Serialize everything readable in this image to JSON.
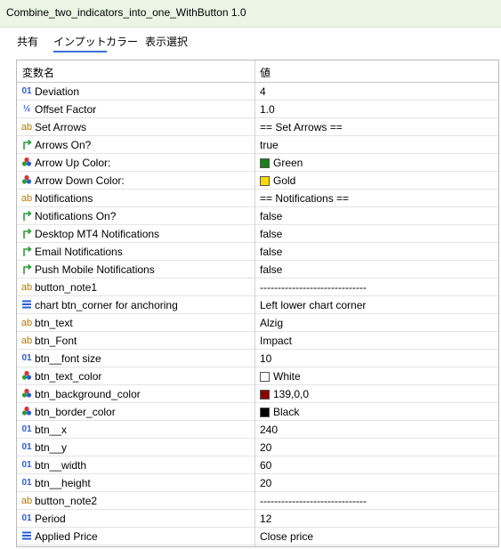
{
  "window": {
    "title": "Combine_two_indicators_into_one_WithButton 1.0"
  },
  "tabs": [
    {
      "label": "共有"
    },
    {
      "label": "インプット"
    },
    {
      "label": "カラー"
    },
    {
      "label": "表示選択"
    }
  ],
  "grid": {
    "header": {
      "name": "変数名",
      "value": "値"
    },
    "rows": [
      {
        "type": "int",
        "name": "Deviation",
        "value": "4"
      },
      {
        "type": "double",
        "name": "Offset Factor",
        "value": "1.0"
      },
      {
        "type": "string",
        "name": "Set Arrows",
        "value": "== Set Arrows =="
      },
      {
        "type": "bool",
        "name": "Arrows On?",
        "value": "true"
      },
      {
        "type": "color",
        "name": "Arrow Up Color:",
        "value": "Green",
        "swatch": "#1a7f1a"
      },
      {
        "type": "color",
        "name": "Arrow Down Color:",
        "value": "Gold",
        "swatch": "#ffd700"
      },
      {
        "type": "string",
        "name": "Notifications",
        "value": "== Notifications =="
      },
      {
        "type": "bool",
        "name": "Notifications On?",
        "value": "false"
      },
      {
        "type": "bool",
        "name": "Desktop MT4 Notifications",
        "value": "false"
      },
      {
        "type": "bool",
        "name": "Email Notifications",
        "value": "false"
      },
      {
        "type": "bool",
        "name": "Push Mobile Notifications",
        "value": "false"
      },
      {
        "type": "string",
        "name": "button_note1",
        "value": "------------------------------"
      },
      {
        "type": "enum",
        "name": "chart btn_corner for anchoring",
        "value": "Left lower chart corner"
      },
      {
        "type": "string",
        "name": "btn_text",
        "value": "Alzig"
      },
      {
        "type": "string",
        "name": "btn_Font",
        "value": "Impact"
      },
      {
        "type": "int",
        "name": "btn__font size",
        "value": "10"
      },
      {
        "type": "color",
        "name": "btn_text_color",
        "value": "White",
        "swatch": "#ffffff"
      },
      {
        "type": "color",
        "name": "btn_background_color",
        "value": "139,0,0",
        "swatch": "#8b0000"
      },
      {
        "type": "color",
        "name": "btn_border_color",
        "value": "Black",
        "swatch": "#000000"
      },
      {
        "type": "int",
        "name": "btn__x",
        "value": "240"
      },
      {
        "type": "int",
        "name": "btn__y",
        "value": "20"
      },
      {
        "type": "int",
        "name": "btn__width",
        "value": "60"
      },
      {
        "type": "int",
        "name": "btn__height",
        "value": "20"
      },
      {
        "type": "string",
        "name": "button_note2",
        "value": "------------------------------"
      },
      {
        "type": "int",
        "name": "Period",
        "value": "12"
      },
      {
        "type": "enum",
        "name": "Applied Price",
        "value": "Close price"
      }
    ]
  }
}
